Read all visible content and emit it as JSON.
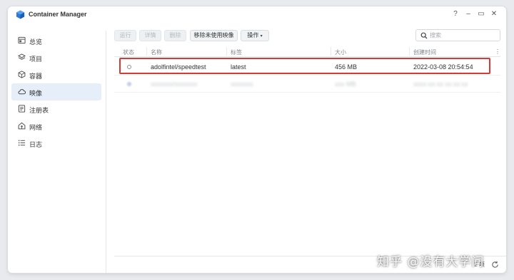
{
  "window": {
    "title": "Container Manager",
    "controls": [
      "?",
      "–",
      "▭",
      "✕"
    ]
  },
  "sidebar": {
    "items": [
      {
        "label": "总览",
        "icon": "overview-icon",
        "active": false
      },
      {
        "label": "项目",
        "icon": "project-icon",
        "active": false
      },
      {
        "label": "容器",
        "icon": "container-icon",
        "active": false
      },
      {
        "label": "映像",
        "icon": "cloud-icon",
        "active": true
      },
      {
        "label": "注册表",
        "icon": "registry-icon",
        "active": false
      },
      {
        "label": "网络",
        "icon": "network-icon",
        "active": false
      },
      {
        "label": "日志",
        "icon": "log-icon",
        "active": false
      }
    ]
  },
  "toolbar": {
    "run_label": "运行",
    "details_label": "详情",
    "delete_label": "删除",
    "remove_unused_label": "移除未使用映像",
    "actions_label": "操作"
  },
  "search": {
    "placeholder": "搜索"
  },
  "table": {
    "headers": [
      "状态",
      "名称",
      "标签",
      "大小",
      "创建时间"
    ],
    "rows": [
      {
        "name": "adolfintel/speedtest",
        "tag": "latest",
        "size": "456 MB",
        "created": "2022-03-08 20:54:54"
      },
      {
        "name": "xxxxxxx/xxxxxxx",
        "tag": "xxxxxxx",
        "size": "xxx MB",
        "created": "xxxx-xx-xx xx:xx:xx"
      }
    ]
  },
  "footer": {
    "count_text": "2 项"
  },
  "watermark": "知乎 @没有大学问",
  "colors": {
    "accent": "#2b6ed9",
    "highlight_border": "#d73a35",
    "active_nav_bg": "#e6eefa"
  }
}
